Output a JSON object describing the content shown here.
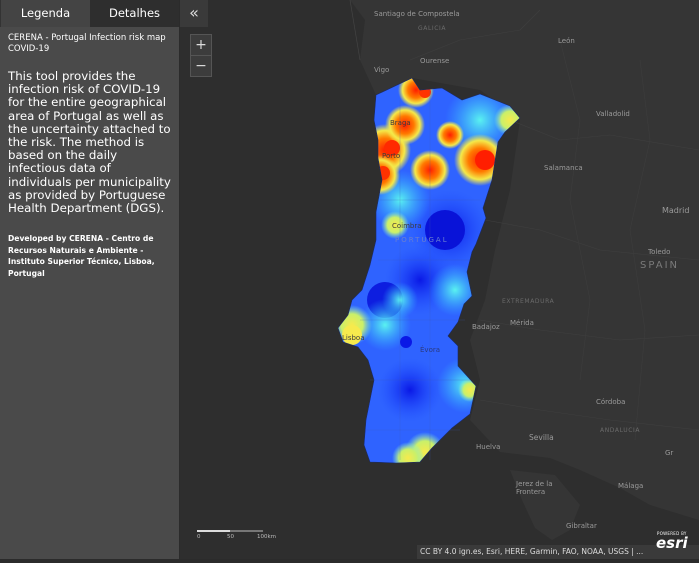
{
  "panel": {
    "tabs": [
      {
        "label": "Legenda"
      },
      {
        "label": "Detalhes"
      }
    ],
    "collapse_icon": "chevrons-left-icon",
    "title": "CERENA - Portugal Infection risk map COVID-19",
    "description": "This tool provides the infection risk of COVID-19 for the entire geographical area of Portugal as well as the uncertainty attached to the risk. The method is based on the daily infectious data of individuals per municipality as provided by Portuguese Health Department (DGS).",
    "credits": "Developed by CERENA - Centro de Recursos Naturais e Ambiente - Instituto Superior Técnico, Lisboa, Portugal"
  },
  "zoom": {
    "in": "+",
    "out": "−"
  },
  "map": {
    "cities": {
      "santiago": "Santiago de Compostela",
      "leon": "León",
      "vigo": "Vigo",
      "ourense": "Ourense",
      "braga": "Braga",
      "porto": "Porto",
      "valladolid": "Valladolid",
      "salamanca": "Salamanca",
      "madrid": "Madrid",
      "toledo": "Toledo",
      "coimbra": "Coimbra",
      "merida": "Mérida",
      "badajoz": "Badajoz",
      "evora": "Évora",
      "lisboa": "Lisboa",
      "cordoba": "Córdoba",
      "sevilla": "Sevilla",
      "huelva": "Huelva",
      "jerez": "Jerez de la Frontera",
      "malaga": "Málaga",
      "gibraltar": "Gibraltar",
      "granada": "Gr"
    },
    "countries": {
      "portugal": "PORTUGAL",
      "spain": "SPAIN"
    },
    "regions": {
      "galicia": "GALICIA",
      "extremadura": "EXTREMADURA",
      "andalucia": "ANDALUCIA"
    },
    "scale": [
      "0",
      "50",
      "100km"
    ],
    "attribution": "CC BY 4.0 ign.es, Esri, HERE, Garmin, FAO, NOAA, USGS | ...",
    "logo": {
      "powered": "POWERED BY",
      "name": "esri"
    }
  },
  "colors": {
    "low": "#1f3fff",
    "mid": "#27a9ff",
    "warm": "#f2ea4a",
    "high": "#ff2a0a",
    "panel": "#4a4a4a"
  }
}
